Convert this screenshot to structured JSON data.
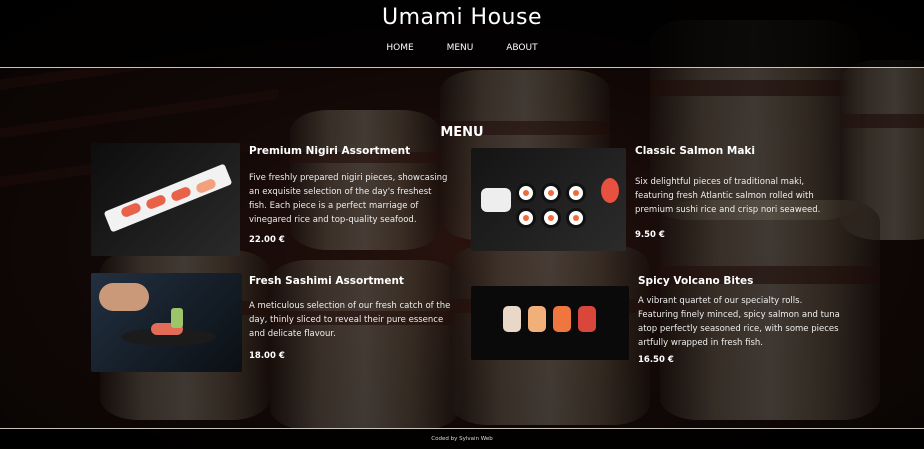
{
  "site": {
    "title": "Umami House"
  },
  "nav": {
    "items": [
      "HOME",
      "MENU",
      "ABOUT"
    ]
  },
  "menu": {
    "title": "MENU",
    "items": [
      {
        "name": "Premium Nigiri Assortment",
        "description": "Five freshly prepared nigiri pieces, showcasing an exquisite selection of the day's freshest fish. Each piece is a perfect marriage of vinegared rice and top-quality seafood.",
        "price": "22.00 €",
        "image_icon": "nigiri-photo"
      },
      {
        "name": "Classic Salmon Maki",
        "description": "Six delightful pieces of traditional maki, featuring fresh Atlantic salmon rolled with premium sushi rice and crisp nori seaweed.",
        "price": "9.50 €",
        "image_icon": "maki-photo"
      },
      {
        "name": "Fresh Sashimi Assortment",
        "description": "A meticulous selection of our fresh catch of the day, thinly sliced to reveal their pure essence and delicate flavour.",
        "price": "18.00 €",
        "image_icon": "sashimi-photo"
      },
      {
        "name": "Spicy Volcano Bites",
        "description": "A vibrant quartet of our specialty rolls. Featuring finely minced, spicy salmon and tuna atop perfectly seasoned rice, with some pieces artfully wrapped in fresh fish.",
        "price": "16.50 €",
        "image_icon": "volcano-photo"
      }
    ]
  },
  "footer": {
    "text": "Coded by Sylvain Web"
  },
  "colors": {
    "header_bg": "#000000",
    "divider": "#c9c2b6",
    "text": "#ffffff"
  }
}
